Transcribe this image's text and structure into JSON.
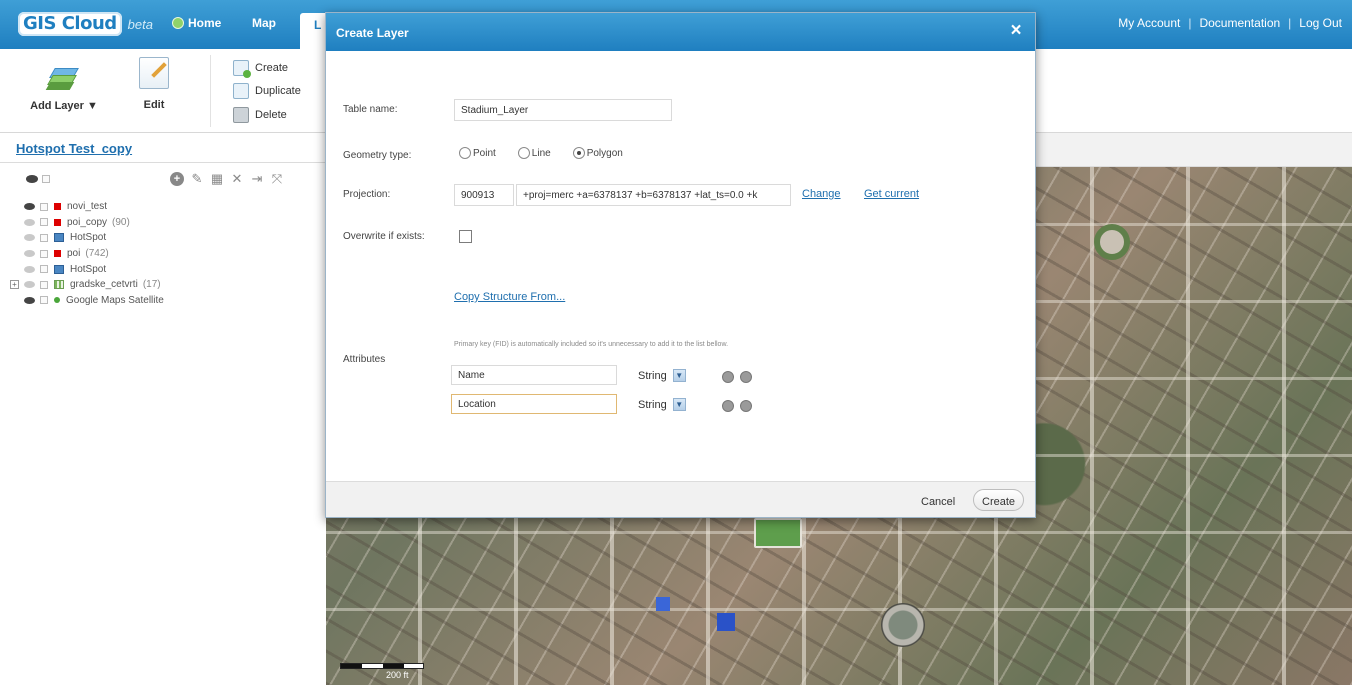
{
  "app": {
    "logo_text": "GIS Cloud",
    "logo_badge": "beta",
    "nav": {
      "home": "Home",
      "map": "Map",
      "active_tab_initial": "L"
    },
    "account_links": [
      "My Account",
      "Documentation",
      "Log Out"
    ],
    "separator": "|"
  },
  "toolbar": {
    "add_layer": "Add Layer ▼",
    "edit": "Edit",
    "create": "Create",
    "duplicate": "Duplicate",
    "delete": "Delete"
  },
  "left_panel": {
    "map_title": "Hotspot Test_copy",
    "layers": [
      {
        "name": "novi_test",
        "count": "",
        "type": "point",
        "visible": true,
        "expander": false
      },
      {
        "name": "poi_copy",
        "count": "(90)",
        "type": "point",
        "visible": false,
        "expander": false
      },
      {
        "name": "HotSpot",
        "count": "",
        "type": "polygon",
        "visible": false,
        "expander": false
      },
      {
        "name": "poi",
        "count": "(742)",
        "type": "point",
        "visible": false,
        "expander": false
      },
      {
        "name": "HotSpot",
        "count": "",
        "type": "polygon",
        "visible": false,
        "expander": false
      },
      {
        "name": "gradske_cetvrti",
        "count": "(17)",
        "type": "grid",
        "visible": false,
        "expander": true
      },
      {
        "name": "Google Maps Satellite",
        "count": "",
        "type": "base",
        "visible": true,
        "expander": false
      }
    ]
  },
  "dialog": {
    "title": "Create Layer",
    "close": "×",
    "table_name_label": "Table name:",
    "table_name_value": "Stadium_Layer",
    "geometry_label": "Geometry type:",
    "geometry_options": [
      "Point",
      "Line",
      "Polygon"
    ],
    "geometry_selected": "Polygon",
    "projection_label": "Projection:",
    "projection_code": "900913",
    "projection_string": "+proj=merc +a=6378137 +b=6378137 +lat_ts=0.0 +k",
    "change_link": "Change",
    "get_current_link": "Get current",
    "overwrite_label": "Overwrite if exists:",
    "copy_structure_link": "Copy Structure From...",
    "attributes_label": "Attributes",
    "attributes_note": "Primary key (FID) is automatically included so it's unnecessary to add it to the list bellow.",
    "attributes": [
      {
        "name": "Name",
        "type": "String"
      },
      {
        "name": "Location",
        "type": "String"
      }
    ],
    "cancel": "Cancel",
    "create": "Create"
  },
  "map": {
    "scale_label": "200 ft"
  },
  "colors": {
    "header_blue": "#1f7fc0",
    "link_blue": "#1f6fae",
    "point_red": "#dd0000"
  }
}
